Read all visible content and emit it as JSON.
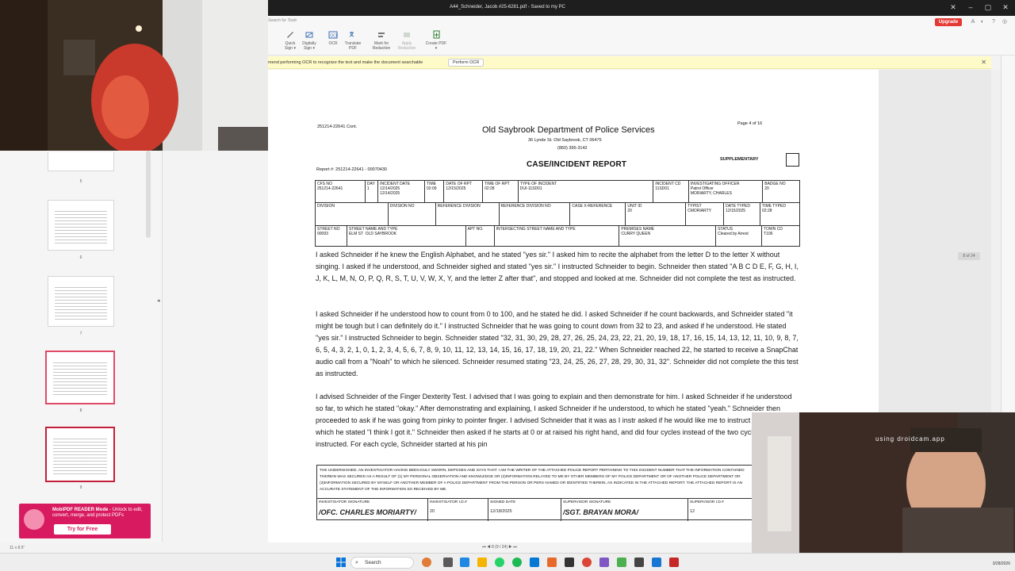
{
  "window": {
    "title": "A44_Schneider, Jacob #25-6281.pdf - Saved to my PC",
    "controls": [
      "✕",
      "–",
      "▢",
      "✕"
    ]
  },
  "toolbar": {
    "search_placeholder": "Search for Tools",
    "tools": [
      {
        "label": "Quick\nSign ▾",
        "icon": "quick-sign-icon"
      },
      {
        "label": "Digitally\nSign ▾",
        "icon": "digital-sign-icon"
      },
      {
        "label": "OCR",
        "icon": "ocr-icon"
      },
      {
        "label": "Translate\nPDF",
        "icon": "translate-icon"
      },
      {
        "label": "Mark for\nRedaction",
        "icon": "redaction-mark-icon"
      },
      {
        "label": "Apply\nRedaction",
        "icon": "redaction-apply-icon"
      },
      {
        "label": "Create PDF\n▾",
        "icon": "create-pdf-icon"
      }
    ],
    "upgrade_label": "Upgrade"
  },
  "ocr_banner": {
    "message": "mend performing OCR to recognize the text and make the document searchable",
    "button": "Perform OCR",
    "close": "✕"
  },
  "sidebar": {
    "thumbnails": [
      {
        "num": "5"
      },
      {
        "num": "6"
      },
      {
        "num": "7"
      },
      {
        "num": "8"
      },
      {
        "num": "9"
      }
    ],
    "promo": {
      "title": "MobiPDF READER Mode",
      "text": "- Unlock to edit, convert, merge, and protect PDFs",
      "button": "Try for Free"
    },
    "size_label": "11 x 8.5\"",
    "collapse_glyph": "◂"
  },
  "document": {
    "case_id_cont": "251214-22641 Cont.",
    "dept": "Old Saybrook Department of Police Services",
    "address": "36 Lynde St. Old Saybrook, CT 06475",
    "phone": "(860) 395-3142",
    "page_label": "Page 4 of 16",
    "supplementary": "SUPPLEMENTARY",
    "report_title": "CASE/INCIDENT REPORT",
    "report_no": "Report #: 251214-22641 - 00070430",
    "table": {
      "row1": [
        "CFS NO\n251214-22641",
        "DAY\n1",
        "INCIDENT DATE\n12/14/2025\n12/14/2025",
        "TIME\n02:09",
        "DATE OF RPT\n12/15/2025",
        "TIME OF RPT\n02:28",
        "TYPE OF INCIDENT\nDUI-11SD01",
        "INCIDENT CD\n11SD01",
        "INVESTIGATING OFFICER\nPatrol Officer\nMORIARTY, CHARLES",
        "BADGE NO\n20"
      ],
      "row2": [
        "DIVISION",
        "DIVISION NO",
        "REFERENCE DIVISION",
        "REFERENCE DIVISION NO",
        "CASE X-REFERENCE",
        "UNIT ID\n20",
        "TYPIST\nCMORIARTY",
        "DATE TYPED\n12/15/2025",
        "TIME TYPED\n02:28"
      ],
      "row3": [
        "STREET NO\n00093",
        "STREET NAME AND TYPE\nELM ST  OLD SAYBROOK",
        "APT NO.",
        "INTERSECTING STREET NAME AND TYPE",
        "PREMISES NAME\nCURRY QUEEN",
        "STATUS\nCleared by Arrest",
        "TOWN CD\nT106"
      ]
    },
    "paragraphs": [
      "I asked Schneider if he knew the English Alphabet, and he stated \"yes sir.\" I asked him to recite the alphabet from the letter D to the letter X without singing. I asked if he understood, and Schneider sighed and stated \"yes sir.\" I instructed Schneider to begin. Schneider then stated \"A B C D E, F, G, H, I, J, K, L, M, N, O, P, Q, R, S, T, U, V, W, X, Y, and the letter Z after that\", and stopped and looked at me. Schneider did not complete the test as instructed.",
      "I asked Schneider if he understood how to count from 0 to 100, and he stated he did. I asked Schneider if he count backwards, and Schneider stated \"it might be tough but I can definitely do it.\" I instructed Schneider that he was going to count down from 32 to 23, and asked if he understood. He stated \"yes sir.\" I instructed Schneider to begin. Schneider stated \"32, 31, 30, 29, 28, 27, 26, 25, 24, 23, 22, 21, 20, 19, 18, 17, 16, 15, 14, 13, 12, 11, 10, 9, 8, 7, 6, 5, 4, 3, 2, 1, 0, 1, 2, 3, 4, 5, 6, 7, 8, 9, 10, 11, 12, 13, 14, 15, 16, 17, 18, 19, 20, 21, 22.\" When Schneider reached 22, he started to receive a SnapChat audio call from a \"Noah\" to which he silenced. Schneider resumed stating \"23, 24, 25, 26, 27, 28, 29, 30, 31, 32\". Schneider did not complete the this test as instructed.",
      "I advised Schneider of the Finger Dexterity Test. I advised that I was going to explain and then demonstrate for him. I asked Schneider if he understood so far, to which he stated \"okay.\" After demonstrating and explaining, I asked Schneider if he understood, to which he stated \"yeah.\" Schneider then proceeded to ask if he was going from pinky to pointer finger. I advised Schneider that it was as I instr asked if he would like me to instruct him again, to which he stated \"I think I got it.\" Schneider then asked if he starts at 0 or at raised his right hand, and did four cycles instead of the two cycles as I instructed. For each cycle, Schneider started at his pin"
    ],
    "cert_text": "THE UNDERSIGNED, AN INVESTIGATOR HAVING BEEN DULY SWORN, DEPOSES AND SAYS THAT: I AM THE WRITER OF THE ATTACHED POLICE REPORT PERTAINING TO THIS INCIDENT NUMBER THAT THE INFORMATION CONTAINED THEREIN WAS SECURED AS A RESULT OF (1) MY PERSONAL OBSERVATION AND KNOWLEDGE OR (2)INFORMATION RELAYED TO ME BY OTHER MEMBERS OF MY POLICE DEPARTMENT OR OF ANOTHER POLICE DEPARTMENT OR (3)INFORMATION SECURED BY MYSELF OR ANOTHER MEMBER OF A POLICE DEPARTMENT FROM THE PERSON OR PERS NAMED OR IDENTIFIED THEREIN, AS INDICATED IN THE ATTACHED REPORT. THE ATTACHED REPORT IS AN ACCURATE STATEMENT OF THE INFORMATION SO RECEIVED BY ME.",
    "signatures": {
      "investigator_label": "INVESTIGATOR SIGNATURE",
      "investigator": "/OFC. CHARLES MORIARTY/",
      "investigator_id_label": "INVESTIGATOR I.D.#",
      "investigator_id": "20",
      "signed_label": "SIGNED DATE",
      "signed_date": "12/18/2025",
      "supervisor_label": "SUPERVISOR SIGNATURE",
      "supervisor": "/SGT. BRAYAN MORA/",
      "supervisor_id_label": "SUPERVISOR I.D.#",
      "supervisor_id": "12"
    }
  },
  "page_chip": "8 of 24",
  "page_nav": "⏮  ◀    8 (9 / 24)    ▶  ⏭",
  "webcam_overlay": {
    "watermark": "using droidcam.app"
  },
  "taskbar": {
    "search_label": "Search",
    "clock": "3/28/2026"
  },
  "colors": {
    "upgrade": "#e53935",
    "promo": "#d81b60",
    "selected_thumb": "#e04a67",
    "banner": "#fffbc8"
  }
}
